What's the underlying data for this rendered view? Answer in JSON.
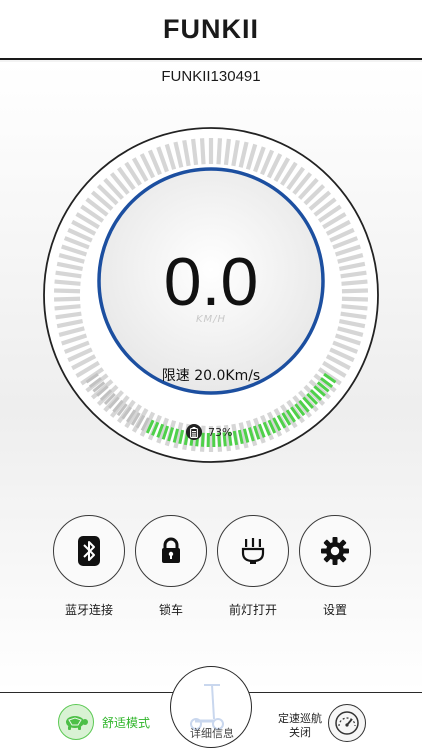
{
  "header": {
    "logo": "FUNKII"
  },
  "device": {
    "name": "FUNKII130491"
  },
  "speed": {
    "value": "0.0",
    "unit": "KM/H",
    "limit_text": "限速 20.0Km/s"
  },
  "battery": {
    "percent_text": "73%",
    "level": 0.73,
    "icon": "battery-icon"
  },
  "controls": [
    {
      "label": "蓝牙连接",
      "icon": "bluetooth-icon"
    },
    {
      "label": "锁车",
      "icon": "lock-icon"
    },
    {
      "label": "前灯打开",
      "icon": "headlight-icon"
    },
    {
      "label": "设置",
      "icon": "gear-icon"
    }
  ],
  "bottom": {
    "mode_label": "舒适模式",
    "mode_icon": "turtle-icon",
    "detail_label": "详细信息",
    "detail_icon": "scooter-icon",
    "cruise_line1": "定速巡航",
    "cruise_line2": "关闭",
    "cruise_icon": "speedometer-icon"
  },
  "colors": {
    "accent_blue": "#1c4fa0",
    "battery_green": "#4fd14a",
    "mode_green": "#2fb52a"
  }
}
